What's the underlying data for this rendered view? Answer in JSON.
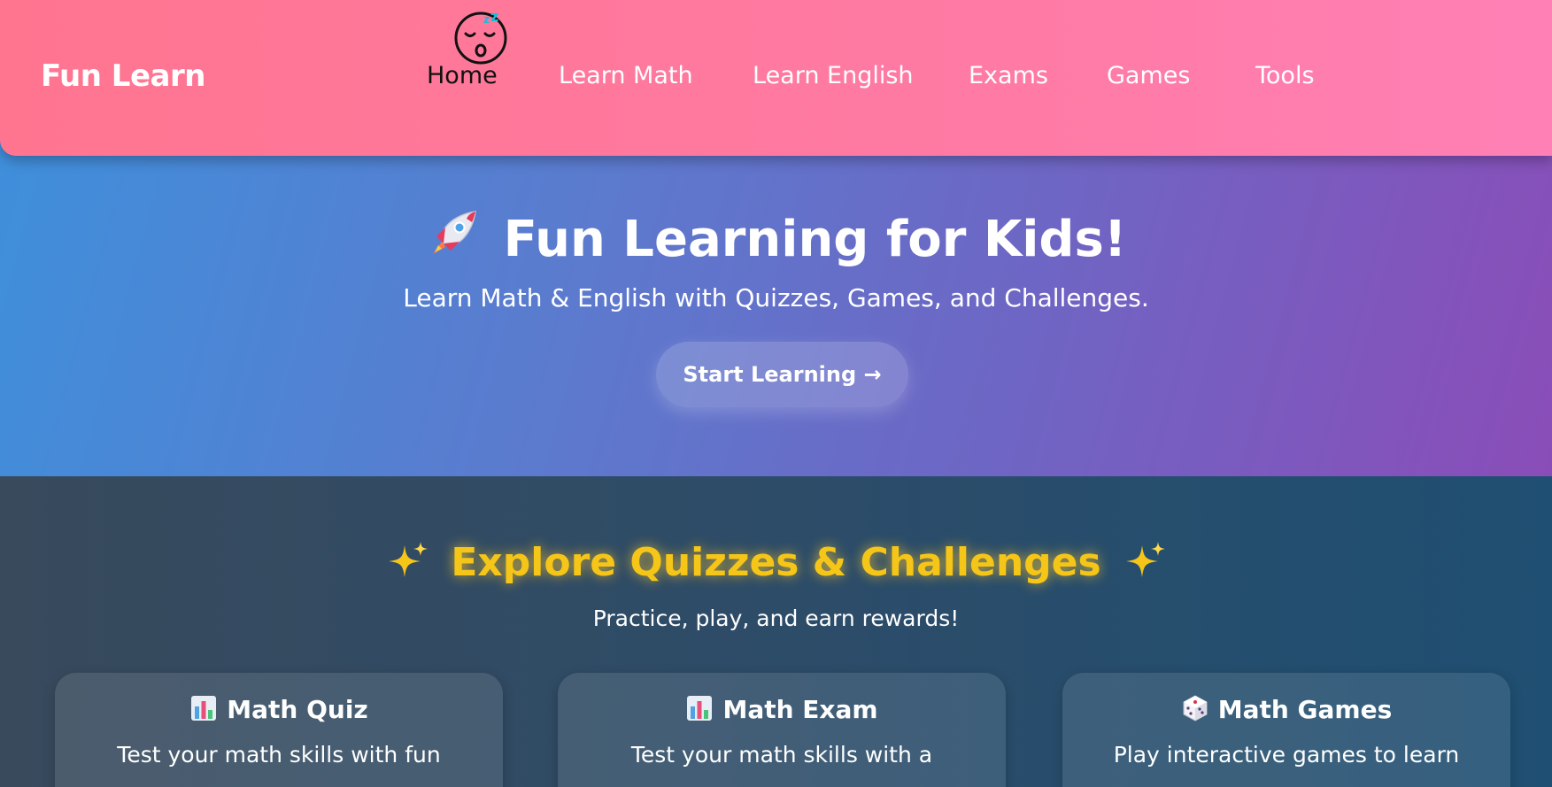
{
  "navbar": {
    "logo": "Fun Learn",
    "items": [
      {
        "label": "Home",
        "active": true
      },
      {
        "label": "Learn Math"
      },
      {
        "label": "Learn English"
      },
      {
        "label": "Exams"
      },
      {
        "label": "Games"
      },
      {
        "label": "Tools"
      }
    ]
  },
  "hero": {
    "title": "Fun Learning for Kids!",
    "subtitle": "Learn Math & English with Quizzes, Games, and Challenges.",
    "cta_label": "Start Learning →"
  },
  "explore": {
    "title": "Explore Quizzes & Challenges",
    "subtitle": "Practice, play, and earn rewards!",
    "cards": [
      {
        "title": "Math Quiz",
        "description": "Test your math skills with fun",
        "icon": "bar-chart-icon"
      },
      {
        "title": "Math Exam",
        "description": "Test your math skills with a",
        "icon": "bar-chart-icon"
      },
      {
        "title": "Math Games",
        "description": "Play interactive games to learn",
        "icon": "dice-icon"
      }
    ]
  },
  "colors": {
    "navbar": "#ff7aa3",
    "hero_start": "#3f8fdb",
    "hero_end": "#8a4db8",
    "explore_bg": "#2d4c68",
    "accent_yellow": "#f5c518"
  }
}
